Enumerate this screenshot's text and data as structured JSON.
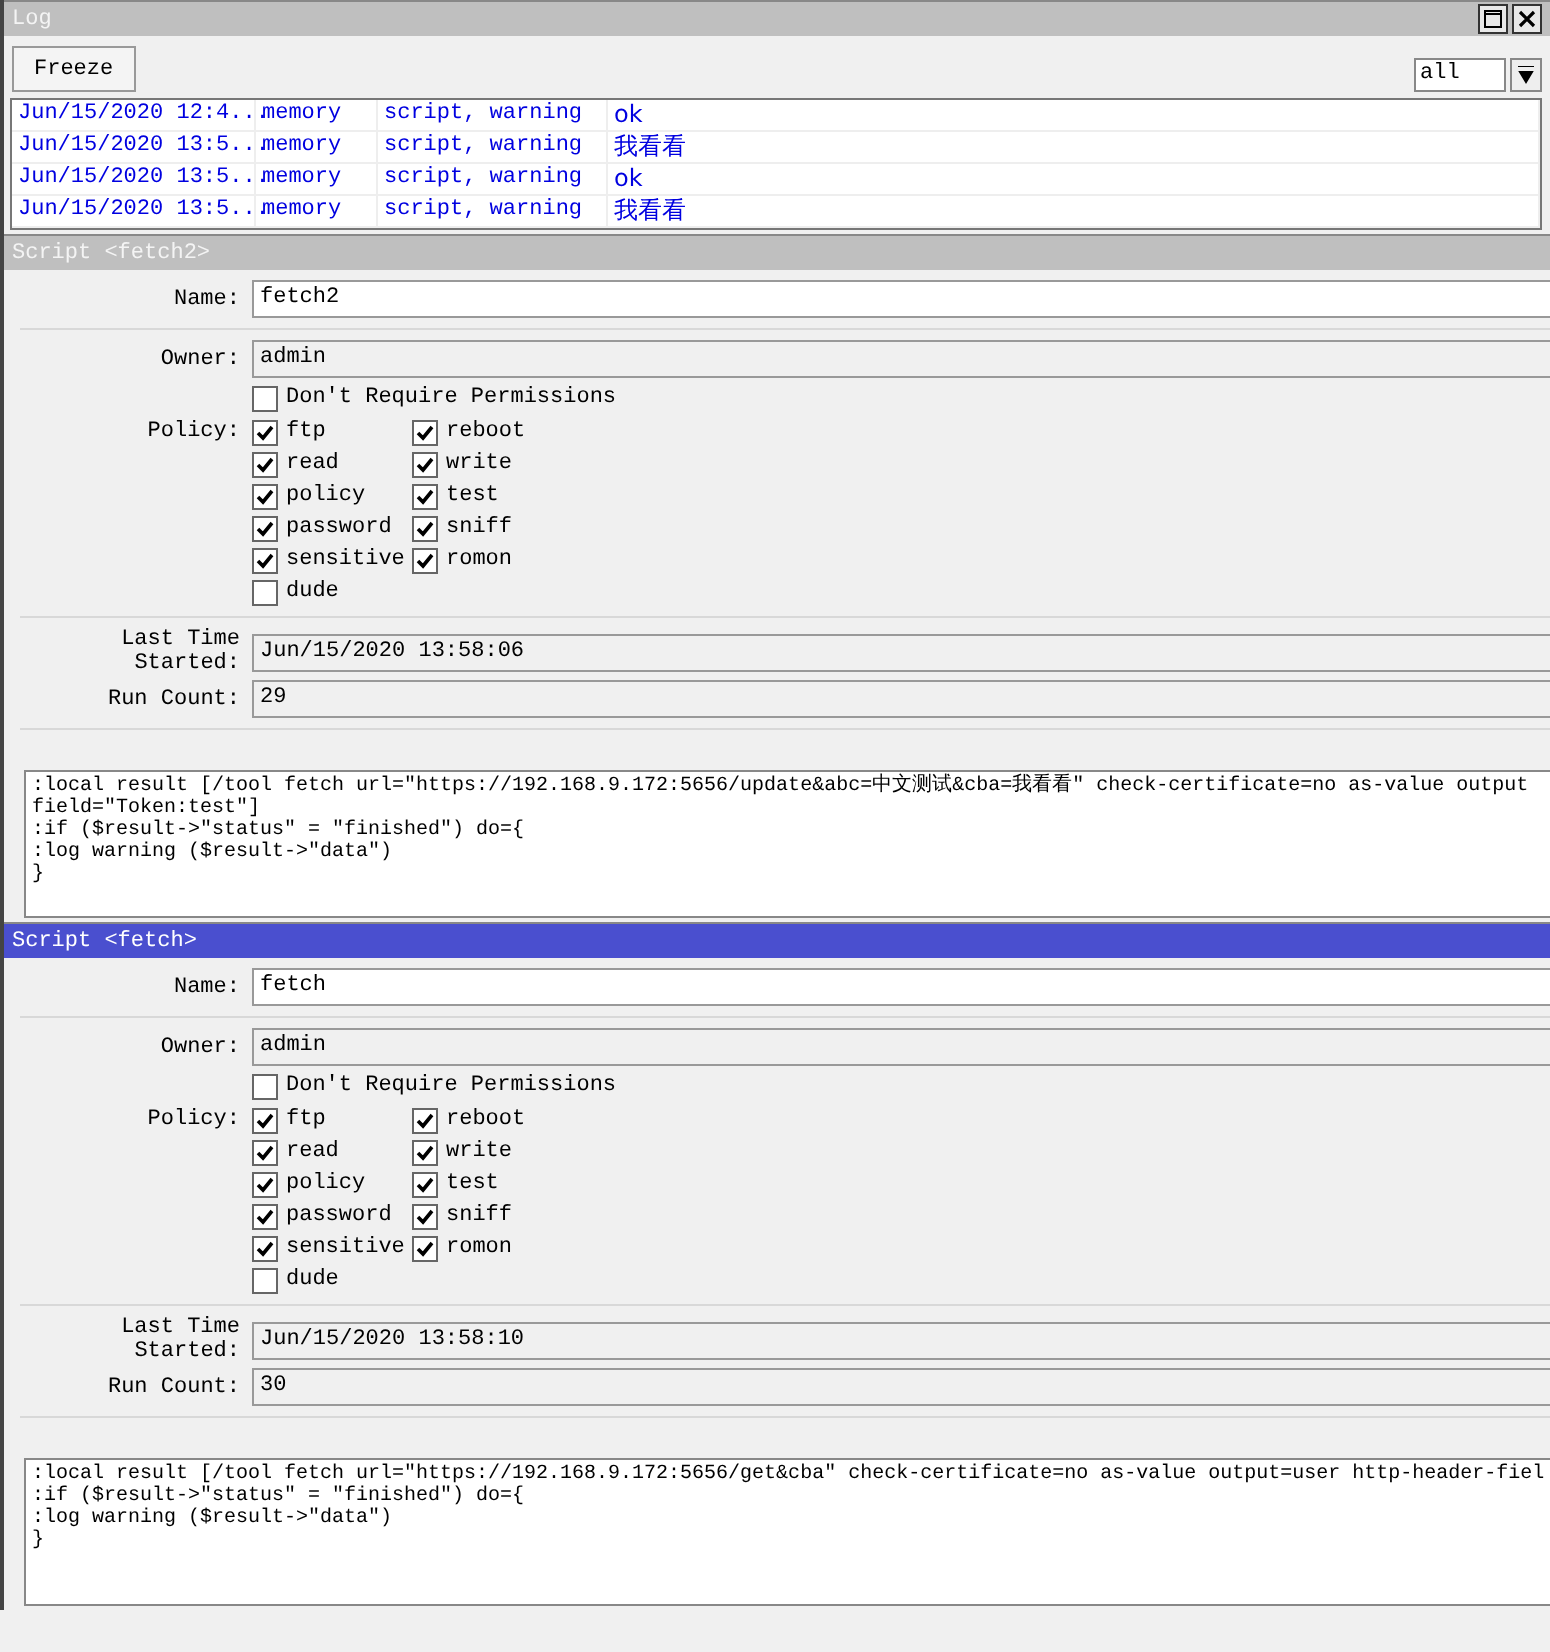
{
  "log": {
    "title": "Log",
    "freeze_button": "Freeze",
    "filter": {
      "value": "all"
    },
    "rows": [
      {
        "time": "Jun/15/2020 12:4...",
        "buffer": "memory",
        "topics": "script, warning",
        "message": "ok"
      },
      {
        "time": "Jun/15/2020 13:5...",
        "buffer": "memory",
        "topics": "script, warning",
        "message": "我看看"
      },
      {
        "time": "Jun/15/2020 13:5...",
        "buffer": "memory",
        "topics": "script, warning",
        "message": "ok"
      },
      {
        "time": "Jun/15/2020 13:5...",
        "buffer": "memory",
        "topics": "script, warning",
        "message": "我看看"
      }
    ]
  },
  "windows": [
    {
      "title": "Script <fetch2>",
      "active": false,
      "name_label": "Name:",
      "name": "fetch2",
      "owner_label": "Owner:",
      "owner": "admin",
      "dont_require": {
        "label": "Don't Require Permissions",
        "checked": false
      },
      "policy_label": "Policy:",
      "policies": [
        {
          "label": "ftp",
          "checked": true
        },
        {
          "label": "read",
          "checked": true
        },
        {
          "label": "policy",
          "checked": true
        },
        {
          "label": "password",
          "checked": true
        },
        {
          "label": "sensitive",
          "checked": true
        },
        {
          "label": "dude",
          "checked": false
        },
        {
          "label": "reboot",
          "checked": true
        },
        {
          "label": "write",
          "checked": true
        },
        {
          "label": "test",
          "checked": true
        },
        {
          "label": "sniff",
          "checked": true
        },
        {
          "label": "romon",
          "checked": true
        }
      ],
      "last_started_label": "Last Time Started:",
      "last_started": "Jun/15/2020 13:58:06",
      "run_count_label": "Run Count:",
      "run_count": "29",
      "source": [
        ":local result [/tool fetch url=\"https://192.168.9.172:5656/update&abc=中文测试&cba=我看看\" check-certificate=no as-value output",
        "field=\"Token:test\"]",
        ":if ($result->\"status\" = \"finished\") do={",
        ":log warning ($result->\"data\")",
        "}"
      ]
    },
    {
      "title": "Script <fetch>",
      "active": true,
      "name_label": "Name:",
      "name": "fetch",
      "owner_label": "Owner:",
      "owner": "admin",
      "dont_require": {
        "label": "Don't Require Permissions",
        "checked": false
      },
      "policy_label": "Policy:",
      "policies": [
        {
          "label": "ftp",
          "checked": true
        },
        {
          "label": "read",
          "checked": true
        },
        {
          "label": "policy",
          "checked": true
        },
        {
          "label": "password",
          "checked": true
        },
        {
          "label": "sensitive",
          "checked": true
        },
        {
          "label": "dude",
          "checked": false
        },
        {
          "label": "reboot",
          "checked": true
        },
        {
          "label": "write",
          "checked": true
        },
        {
          "label": "test",
          "checked": true
        },
        {
          "label": "sniff",
          "checked": true
        },
        {
          "label": "romon",
          "checked": true
        }
      ],
      "last_started_label": "Last Time Started:",
      "last_started": "Jun/15/2020 13:58:10",
      "run_count_label": "Run Count:",
      "run_count": "30",
      "source": [
        ":local result [/tool fetch url=\"https://192.168.9.172:5656/get&cba\" check-certificate=no as-value output=user http-header-fiel",
        ":if ($result->\"status\" = \"finished\") do={",
        ":log warning ($result->\"data\")",
        "}"
      ]
    }
  ]
}
